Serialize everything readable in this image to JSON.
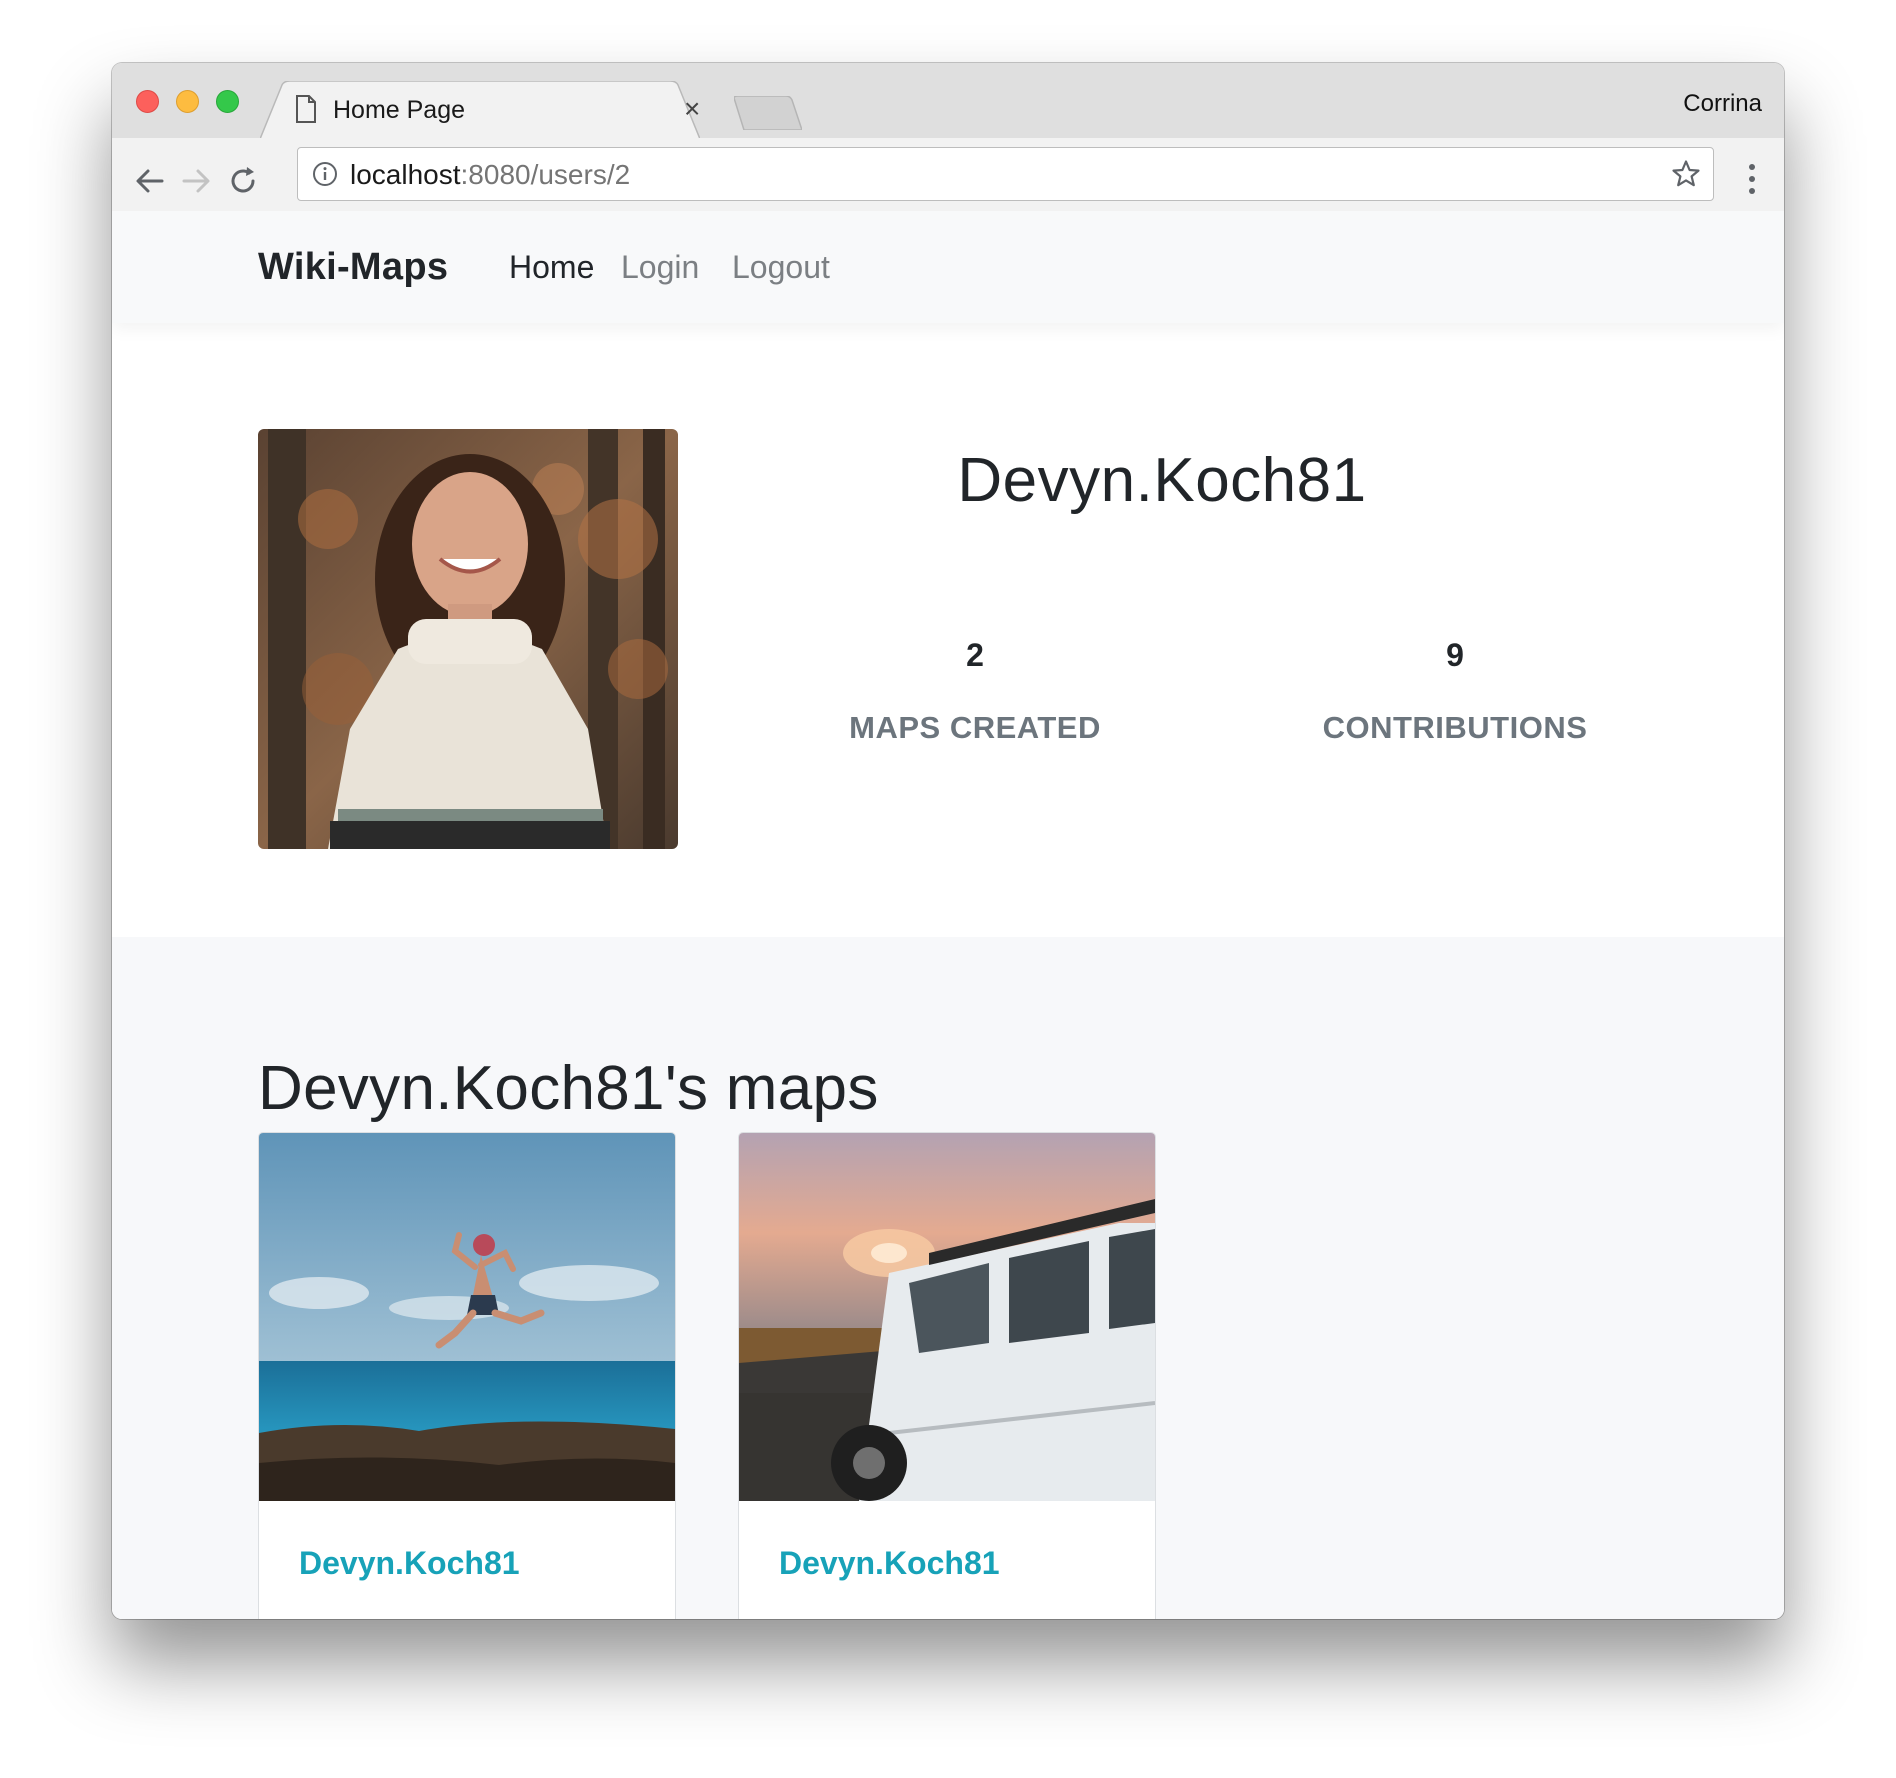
{
  "browser": {
    "tab_title": "Home Page",
    "tab_close": "×",
    "profile_name": "Corrina",
    "url_host": "localhost",
    "url_rest": ":8080/users/2"
  },
  "nav": {
    "brand": "Wiki-Maps",
    "links": [
      "Home",
      "Login",
      "Logout"
    ],
    "active": "Home"
  },
  "profile": {
    "username": "Devyn.Koch81",
    "stats": [
      {
        "value": "2",
        "label": "MAPS CREATED"
      },
      {
        "value": "9",
        "label": "CONTRIBUTIONS"
      }
    ]
  },
  "maps": {
    "heading": "Devyn.Koch81's maps",
    "cards": [
      {
        "author": "Devyn.Koch81",
        "photo_icon": "runner-jumping-by-sea-photo"
      },
      {
        "author": "Devyn.Koch81",
        "photo_icon": "white-jeep-at-sunset-photo"
      }
    ]
  },
  "colors": {
    "link_teal": "#17a2b8",
    "muted_label": "#6c757d",
    "text_dark": "#212529",
    "navbar_bg": "#f8f9fa"
  }
}
